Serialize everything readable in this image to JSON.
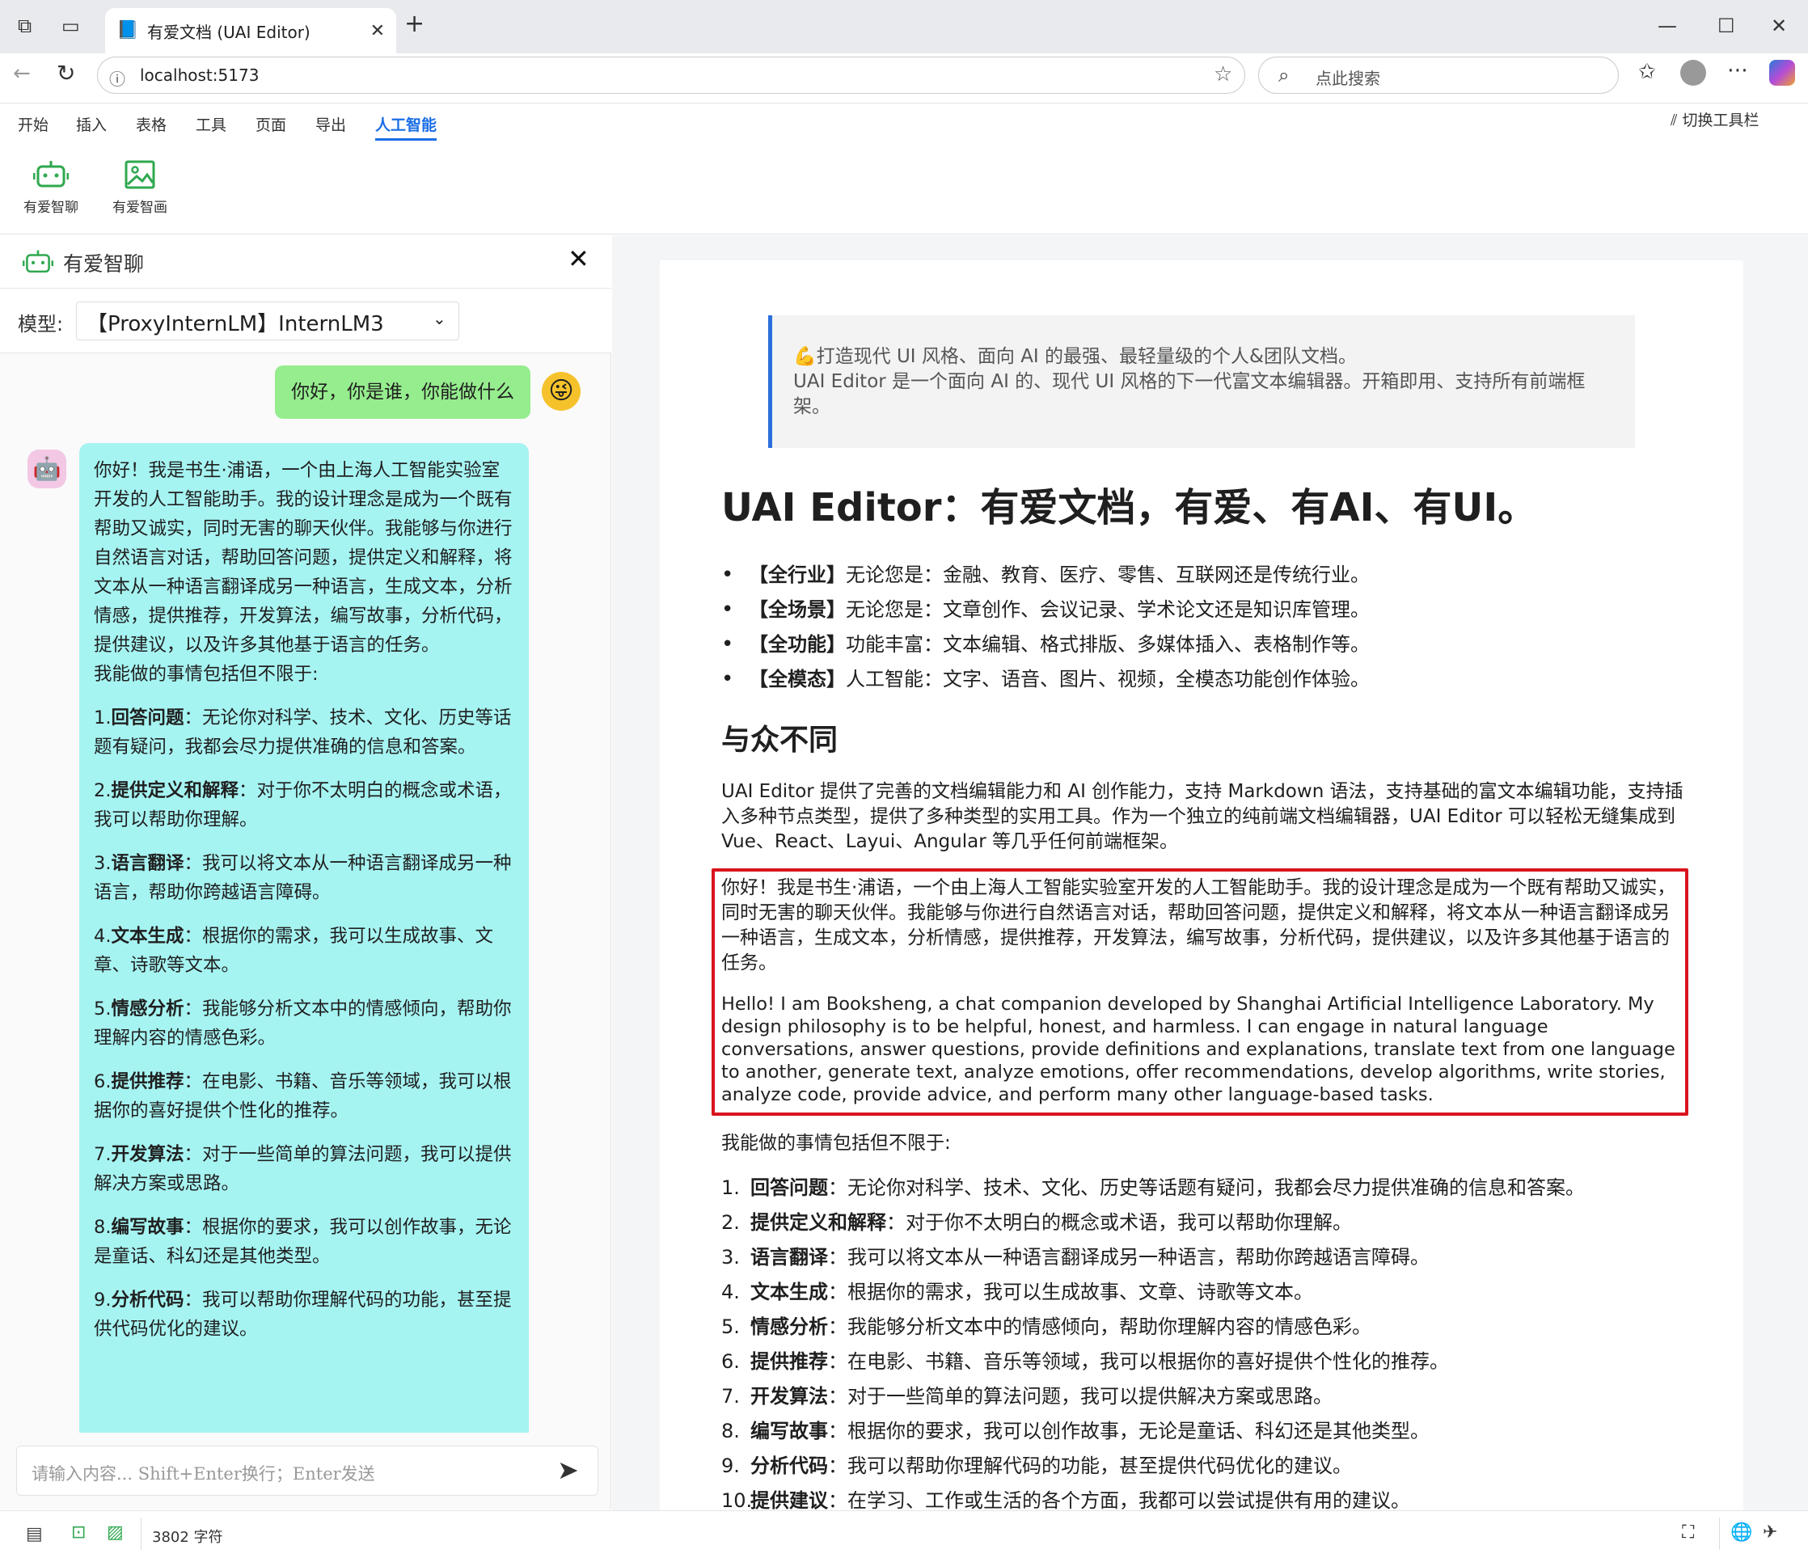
{
  "browser": {
    "tab_title": "有爱文档 (UAI Editor)",
    "url": "localhost:5173",
    "search_placeholder": "点此搜索"
  },
  "menu": {
    "items": [
      "开始",
      "插入",
      "表格",
      "工具",
      "页面",
      "导出",
      "人工智能"
    ],
    "active": "人工智能",
    "toggle_toolbar": "切换工具栏"
  },
  "ribbon": {
    "chat_label": "有爱智聊",
    "draw_label": "有爱智画"
  },
  "chat": {
    "title": "有爱智聊",
    "model_label": "模型:",
    "model_value": "【ProxyInternLM】InternLM3",
    "user_message": "你好，你是谁，你能做什么",
    "bot_intro": "你好！我是书生·浦语，一个由上海人工智能实验室开发的人工智能助手。我的设计理念是成为一个既有帮助又诚实，同时无害的聊天伙伴。我能够与你进行自然语言对话，帮助回答问题，提供定义和解释，将文本从一种语言翻译成另一种语言，生成文本，分析情感，提供推荐，开发算法，编写故事，分析代码，提供建议，以及许多其他基于语言的任务。",
    "bot_can": "我能做的事情包括但不限于:",
    "bot_items": [
      {
        "n": "1.",
        "k": "回答问题",
        "v": "：无论你对科学、技术、文化、历史等话题有疑问，我都会尽力提供准确的信息和答案。"
      },
      {
        "n": "2.",
        "k": "提供定义和解释",
        "v": "：对于你不太明白的概念或术语，我可以帮助你理解。"
      },
      {
        "n": "3.",
        "k": "语言翻译",
        "v": "：我可以将文本从一种语言翻译成另一种语言，帮助你跨越语言障碍。"
      },
      {
        "n": "4.",
        "k": "文本生成",
        "v": "：根据你的需求，我可以生成故事、文章、诗歌等文本。"
      },
      {
        "n": "5.",
        "k": "情感分析",
        "v": "：我能够分析文本中的情感倾向，帮助你理解内容的情感色彩。"
      },
      {
        "n": "6.",
        "k": "提供推荐",
        "v": "：在电影、书籍、音乐等领域，我可以根据你的喜好提供个性化的推荐。"
      },
      {
        "n": "7.",
        "k": "开发算法",
        "v": "：对于一些简单的算法问题，我可以提供解决方案或思路。"
      },
      {
        "n": "8.",
        "k": "编写故事",
        "v": "：根据你的要求，我可以创作故事，无论是童话、科幻还是其他类型。"
      },
      {
        "n": "9.",
        "k": "分析代码",
        "v": "：我可以帮助你理解代码的功能，甚至提供代码优化的建议。"
      }
    ],
    "input_placeholder": "请输入内容... Shift+Enter换行；Enter发送"
  },
  "status": {
    "char_count": "3802 字符"
  },
  "doc": {
    "quote_line1": "💪打造现代 UI 风格、面向 AI 的最强、最轻量级的个人&团队文档。",
    "quote_line2": "UAI Editor 是一个面向 AI 的、现代 UI 风格的下一代富文本编辑器。开箱即用、支持所有前端框架。",
    "h1": "UAI Editor：有爱文档，有爱、有AI、有UI。",
    "features": [
      {
        "k": "【全行业】",
        "v": "无论您是：金融、教育、医疗、零售、互联网还是传统行业。"
      },
      {
        "k": "【全场景】",
        "v": "无论您是：文章创作、会议记录、学术论文还是知识库管理。"
      },
      {
        "k": "【全功能】",
        "v": "功能丰富：文本编辑、格式排版、多媒体插入、表格制作等。"
      },
      {
        "k": "【全模态】",
        "v": "人工智能：文字、语音、图片、视频，全模态功能创作体验。"
      }
    ],
    "h2": "与众不同",
    "para": "UAI Editor 提供了完善的文档编辑能力和 AI 创作能力，支持 Markdown 语法，支持基础的富文本编辑功能，支持插入多种节点类型，提供了多种类型的实用工具。作为一个独立的纯前端文档编辑器，UAI Editor 可以轻松无缝集成到 Vue、React、Layui、Angular 等几乎任何前端框架。",
    "zh_answer": "你好！我是书生·浦语，一个由上海人工智能实验室开发的人工智能助手。我的设计理念是成为一个既有帮助又诚实，同时无害的聊天伙伴。我能够与你进行自然语言对话，帮助回答问题，提供定义和解释，将文本从一种语言翻译成另一种语言，生成文本，分析情感，提供推荐，开发算法，编写故事，分析代码，提供建议，以及许多其他基于语言的任务。",
    "en_answer": "Hello! I am Booksheng, a chat companion developed by Shanghai Artificial Intelligence Laboratory. My design philosophy is to be helpful, honest, and harmless. I can engage in natural language conversations, answer questions, provide definitions and explanations, translate text from one language to another, generate text, analyze emotions, offer recommendations, develop algorithms, write stories, analyze code, provide advice, and perform many other language-based tasks.",
    "can_do": "我能做的事情包括但不限于:",
    "caps": [
      {
        "n": "1.",
        "k": "回答问题",
        "v": "：无论你对科学、技术、文化、历史等话题有疑问，我都会尽力提供准确的信息和答案。"
      },
      {
        "n": "2.",
        "k": "提供定义和解释",
        "v": "：对于你不太明白的概念或术语，我可以帮助你理解。"
      },
      {
        "n": "3.",
        "k": "语言翻译",
        "v": "：我可以将文本从一种语言翻译成另一种语言，帮助你跨越语言障碍。"
      },
      {
        "n": "4.",
        "k": "文本生成",
        "v": "：根据你的需求，我可以生成故事、文章、诗歌等文本。"
      },
      {
        "n": "5.",
        "k": "情感分析",
        "v": "：我能够分析文本中的情感倾向，帮助你理解内容的情感色彩。"
      },
      {
        "n": "6.",
        "k": "提供推荐",
        "v": "：在电影、书籍、音乐等领域，我可以根据你的喜好提供个性化的推荐。"
      },
      {
        "n": "7.",
        "k": "开发算法",
        "v": "：对于一些简单的算法问题，我可以提供解决方案或思路。"
      },
      {
        "n": "8.",
        "k": "编写故事",
        "v": "：根据你的要求，我可以创作故事，无论是童话、科幻还是其他类型。"
      },
      {
        "n": "9.",
        "k": "分析代码",
        "v": "：我可以帮助你理解代码的功能，甚至提供代码优化的建议。"
      },
      {
        "n": "10.",
        "k": "提供建议",
        "v": "：在学习、工作或生活的各个方面，我都可以尝试提供有用的建议。"
      }
    ]
  },
  "colors": {
    "accent": "#1a6ee6",
    "user_bubble": "#96ed8e",
    "bot_bubble": "#a6f4f2",
    "highlight_border": "#d9141e",
    "ai_icon": "#2fa84f"
  }
}
